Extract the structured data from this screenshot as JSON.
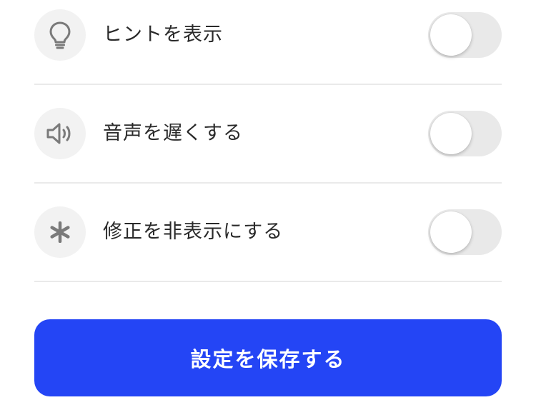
{
  "settings": {
    "items": [
      {
        "label": "ヒントを表示",
        "icon": "lightbulb-icon",
        "enabled": false
      },
      {
        "label": "音声を遅くする",
        "icon": "speaker-icon",
        "enabled": false
      },
      {
        "label": "修正を非表示にする",
        "icon": "asterisk-icon",
        "enabled": false
      }
    ]
  },
  "save_button": {
    "label": "設定を保存する"
  },
  "colors": {
    "accent": "#2445f5",
    "icon_gray": "#7a7a7a",
    "toggle_off": "#e9e9e9"
  }
}
